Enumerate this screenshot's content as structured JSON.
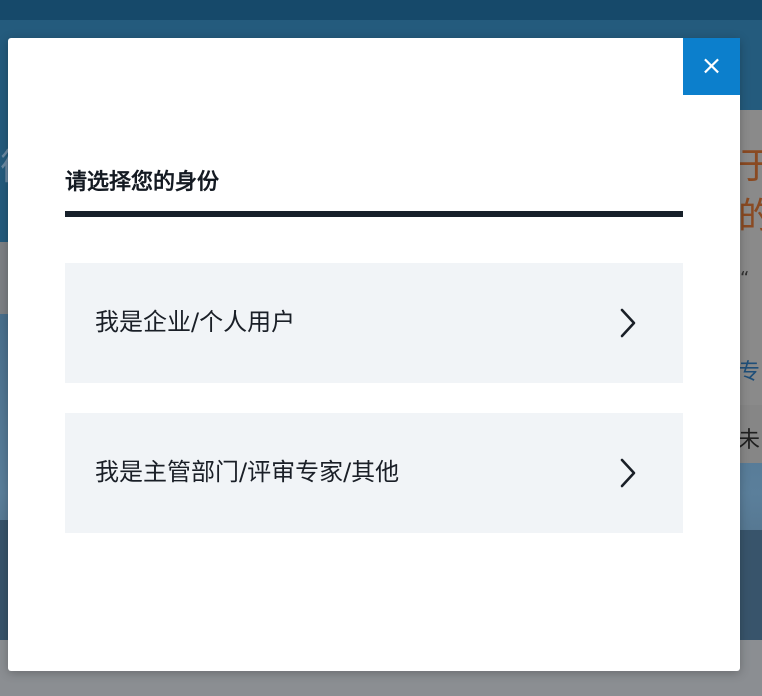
{
  "modal": {
    "title": "请选择您的身份",
    "close_icon": "close-icon",
    "close_glyph": "×",
    "options": [
      {
        "label": "我是企业/个人用户",
        "icon": "chevron-right-icon"
      },
      {
        "label": "我是主管部门/评审专家/其他",
        "icon": "chevron-right-icon"
      }
    ]
  },
  "background": {
    "fragments": {
      "orange": "于的",
      "small": "“",
      "blue": "专",
      "dark": "未",
      "left": "衡"
    }
  },
  "colors": {
    "accent": "#0c7fcc",
    "title_rule": "#17202a",
    "option_bg": "#f1f4f7",
    "overlay_top": "#16496a"
  }
}
